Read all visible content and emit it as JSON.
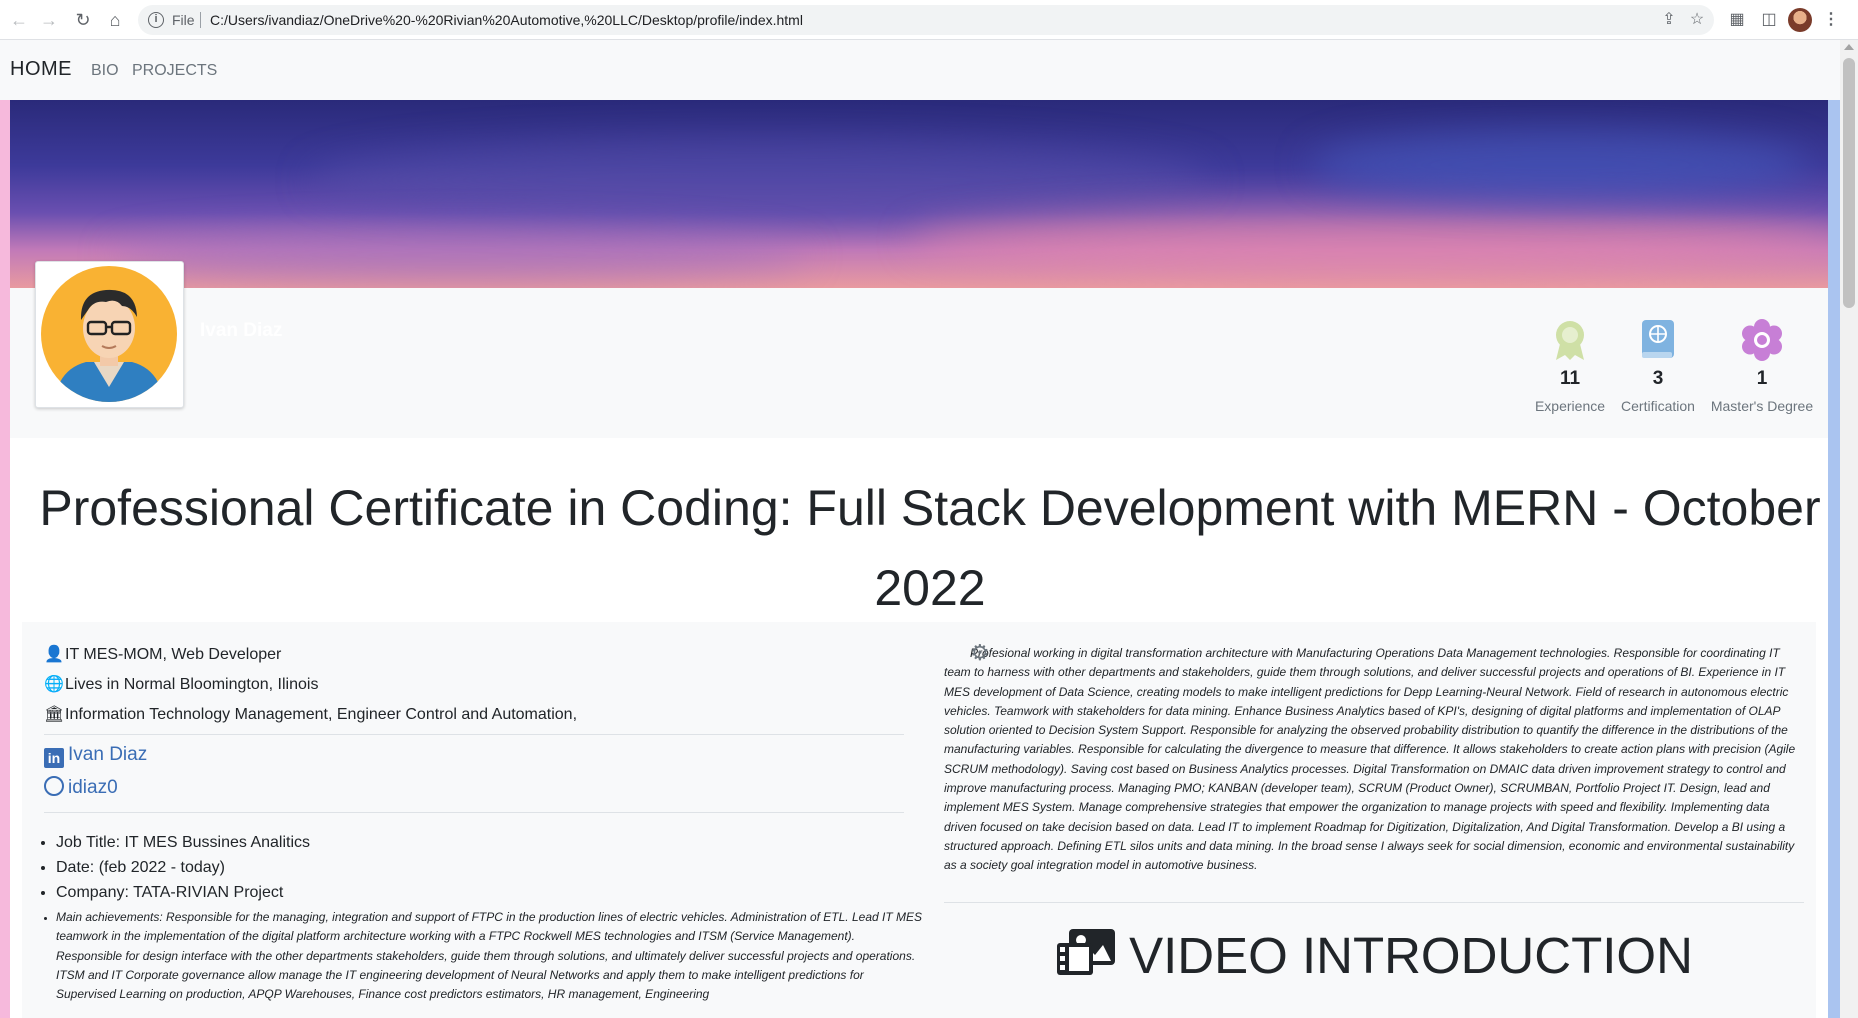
{
  "browser": {
    "file_label": "File",
    "url": "C:/Users/ivandiaz/OneDrive%20-%20Rivian%20Automotive,%20LLC/Desktop/profile/index.html"
  },
  "navbar": {
    "brand": "HOME",
    "links": [
      "BIO",
      "PROJECTS"
    ]
  },
  "profile": {
    "name": "Ivan Diaz"
  },
  "stats": [
    {
      "icon": "award-icon",
      "value": "11",
      "label": "Experience",
      "color": "#cfe0a6"
    },
    {
      "icon": "book-icon",
      "value": "3",
      "label": "Certification",
      "color": "#7fb3e0"
    },
    {
      "icon": "flower-icon",
      "value": "1",
      "label": "Master's Degree",
      "color": "#c77fd6"
    }
  ],
  "headline": "Professional Certificate in Coding: Full Stack Development with MERN - October 2022",
  "info": {
    "job": "IT MES-MOM, Web Developer",
    "location": "Lives in Normal Bloomington, Ilinois",
    "education": "Information Technology Management, Engineer Control and Automation,"
  },
  "social": {
    "linkedin": "Ivan Diaz",
    "github": "idiaz0"
  },
  "job": {
    "title": "Job Title: IT MES Bussines Analitics",
    "date": "Date: (feb 2022 - today)",
    "company": "Company: TATA-RIVIAN Project",
    "achievements": "Main achievements: Responsible for the managing, integration and support of FTPC in the production lines of electric vehicles. Administration of ETL. Lead IT MES teamwork in the implementation of the digital platform architecture working with a FTPC Rockwell MES technologies and ITSM (Service Management). Responsible for design interface with the other departments stakeholders, guide them through solutions, and ultimately deliver successful projects and operations. ITSM and IT Corporate governance allow manage the IT engineering development of Neural Networks and apply them to make intelligent predictions for Supervised Learning on production, APQP Warehouses, Finance cost predictors estimators, HR management, Engineering"
  },
  "bio": "Profesional working in digital transformation architecture with Manufacturing Operations Data Management technologies. Responsible for coordinating IT team to harness with other departments and stakeholders, guide them through solutions, and deliver successful projects and operations of BI. Experience in IT MES development of Data Science, creating models to make intelligent predictions for Depp Learning-Neural Network. Field of research in autonomous electric vehicles. Teamwork with stakeholders for data mining. Enhance Business Analytics based of KPI's, designing of digital platforms and implementation of OLAP solution oriented to Decision System Support. Responsible for analyzing the observed probability distribution to quantify the difference in the distributions of the manufacturing variables. Responsible for calculating the divergence to measure that difference. It allows stakeholders to create action plans with precision (Agile SCRUM methodology). Saving cost based on Business Analytics processes. Digital Transformation on DMAIC data driven improvement strategy to control and improve manufacturing process. Managing PMO; KANBAN (developer team), SCRUM (Product Owner), SCRUMBAN, Portfolio Project IT. Design, lead and implement MES System. Manage comprehensive strategies that empower the organization to manage projects with speed and flexibility. Implementing data driven focused on take decision based on data. Lead IT to implement Roadmap for Digitization, Digitalization, And Digital Transformation. Develop a BI using a structured approach. Defining ETL silos units and data mining. In the broad sense I always seek for social dimension, economic and environmental sustainability as a society goal integration model in automotive business.",
  "video": {
    "title": "VIDEO INTRODUCTION"
  }
}
